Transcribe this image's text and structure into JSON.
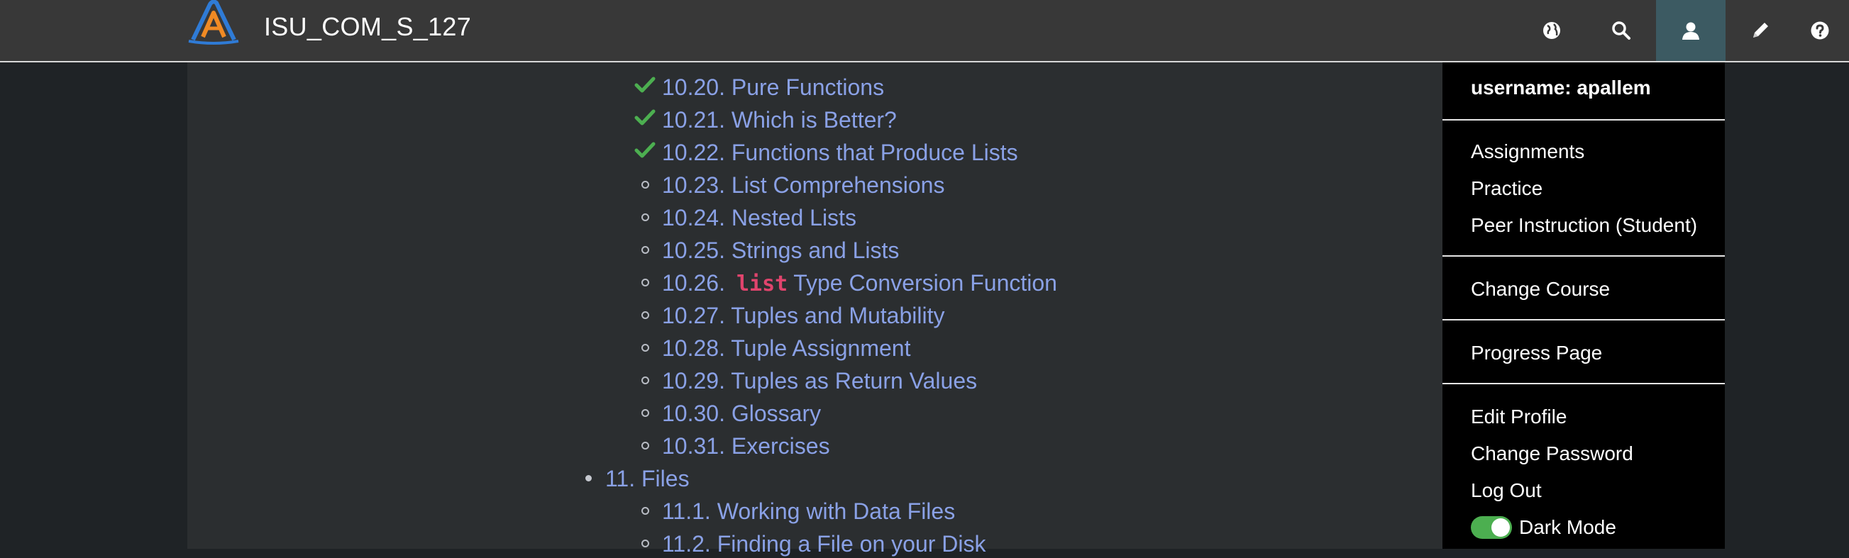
{
  "app": {
    "title": "ISU_COM_S_127"
  },
  "colors": {
    "navbar": "#383838",
    "active_nav": "#3c5a62",
    "link": "#8aa1e6",
    "check": "#4caf50",
    "code": "#e0446d",
    "dropdown_bg": "#000000",
    "toggle_on": "#4caf50"
  },
  "nav_icons": [
    {
      "name": "globe-icon"
    },
    {
      "name": "search-icon"
    },
    {
      "name": "user-icon",
      "active": true
    },
    {
      "name": "pencil-icon"
    },
    {
      "name": "help-icon"
    }
  ],
  "toc": {
    "items": [
      {
        "label": "10.20. Pure Functions",
        "marker": "check"
      },
      {
        "label": "10.21. Which is Better?",
        "marker": "check"
      },
      {
        "label": "10.22. Functions that Produce Lists",
        "marker": "check"
      },
      {
        "label": "10.23. List Comprehensions",
        "marker": "circle"
      },
      {
        "label": "10.24. Nested Lists",
        "marker": "circle"
      },
      {
        "label": "10.25. Strings and Lists",
        "marker": "circle"
      },
      {
        "label_prefix": "10.26.",
        "code": "list",
        "label_suffix": "Type Conversion Function",
        "marker": "circle"
      },
      {
        "label": "10.27. Tuples and Mutability",
        "marker": "circle"
      },
      {
        "label": "10.28. Tuple Assignment",
        "marker": "circle"
      },
      {
        "label": "10.29. Tuples as Return Values",
        "marker": "circle"
      },
      {
        "label": "10.30. Glossary",
        "marker": "circle"
      },
      {
        "label": "10.31. Exercises",
        "marker": "circle"
      },
      {
        "label": "11. Files",
        "marker": "dot"
      },
      {
        "label": "11.1. Working with Data Files",
        "marker": "circle"
      },
      {
        "label": "11.2. Finding a File on your Disk",
        "marker": "circle"
      }
    ]
  },
  "user_menu": {
    "username": "username: apallem",
    "items": [
      "Assignments",
      "Practice",
      "Peer Instruction (Student)"
    ],
    "change_course": "Change Course",
    "progress": "Progress Page",
    "account_items": [
      "Edit Profile",
      "Change Password",
      "Log Out"
    ],
    "dark_mode": {
      "label": "Dark Mode",
      "on": true
    }
  }
}
